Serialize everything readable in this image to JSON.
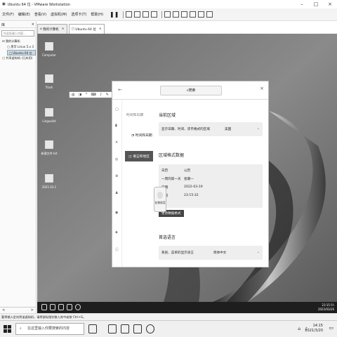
{
  "window": {
    "title": "Ubuntu 64 位 - VMware Workstation"
  },
  "menus": [
    "文件(F)",
    "编辑(E)",
    "查看(V)",
    "虚拟机(M)",
    "选项卡(T)",
    "帮助(H)"
  ],
  "library": {
    "title": "库",
    "close": "×",
    "search_placeholder": "在此处键入内容...",
    "nodes": [
      "我的计算机",
      "黑苹 Linux 5.x 3",
      "Ubuntu 64 位",
      "共享虚拟机 (已弃用)"
    ],
    "bottom_left": "<",
    "bottom_right": ">"
  },
  "vm_tabs": [
    {
      "label": "我的计算机",
      "close": "×"
    },
    {
      "label": "Ubuntu 64 位",
      "close": "×"
    }
  ],
  "desktop_icons": [
    {
      "label": "Computer"
    },
    {
      "label": "Trash"
    },
    {
      "label": "Lingualist"
    },
    {
      "label": "新建文件.txt"
    },
    {
      "label": "2021.03.1"
    }
  ],
  "settings": {
    "search_text": "搜索",
    "back": "←",
    "close": "×",
    "subnav": {
      "title": "时间和日期",
      "item_date": "时间和日期",
      "item_format": "语言和地区"
    },
    "current_region": {
      "title": "当前区域",
      "label": "显示日期、时间、货币格式的区域",
      "value": "美国"
    },
    "region_format": {
      "title": "区域格式数据",
      "rows": [
        {
          "k": "日历",
          "v": "公历"
        },
        {
          "k": "一周的第一天",
          "v": "星期一"
        },
        {
          "k": "日期",
          "v": "2022-03-19"
        },
        {
          "k": "时间",
          "v": "23:15:32"
        }
      ],
      "button": "更改数据格式"
    },
    "first_language": {
      "title": "首选语言",
      "label": "系统、菜单的显示语言",
      "value": "简体中文"
    },
    "popup_text": "长按说话"
  },
  "ubuntu_taskbar": {
    "time": "23:15 Fri",
    "date": "2022/03/26"
  },
  "status_text": "要将输入定向到该虚拟机，请将鼠标指针移入其中或按 Ctrl+G。",
  "win_taskbar": {
    "search_placeholder": "在这里输入你要搜索的内容",
    "time": "14:15",
    "date": "2021/3/20"
  }
}
